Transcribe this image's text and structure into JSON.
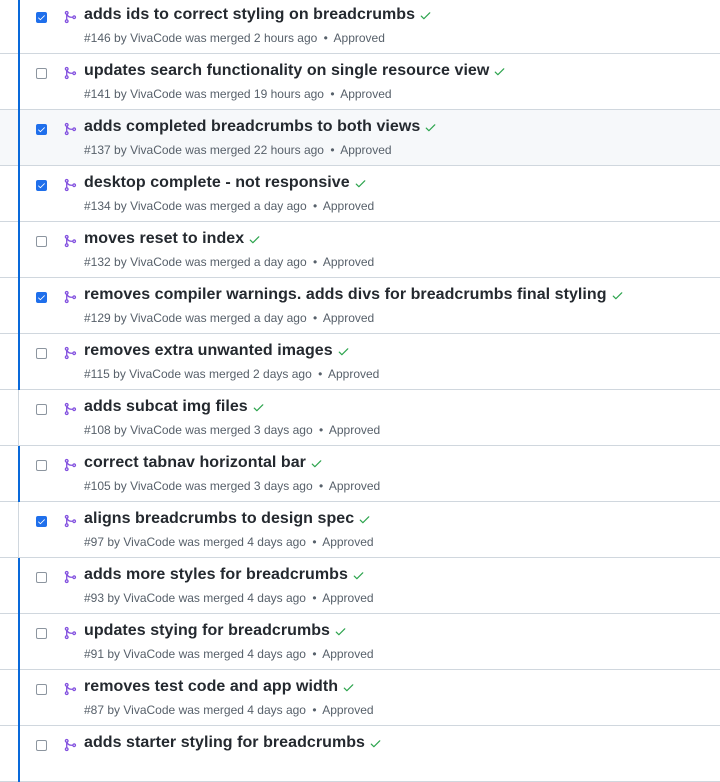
{
  "colors": {
    "accent_bar": "#0969da",
    "checkbox_checked": "#1f6feb",
    "merged_icon": "#8250df",
    "success_check": "#2da44e",
    "title_text": "#24292f",
    "meta_text": "#57606a"
  },
  "icons": {
    "merged": "git-merge-icon",
    "status": "check-icon",
    "checkbox": "checkbox"
  },
  "pull_requests": [
    {
      "title": "adds ids to correct styling on breadcrumbs",
      "number": "#146",
      "author": "VivaCode",
      "merged_text": "was merged 2 hours ago",
      "review": "Approved",
      "checked": true,
      "bar": true,
      "highlighted": false
    },
    {
      "title": "updates search functionality on single resource view",
      "number": "#141",
      "author": "VivaCode",
      "merged_text": "was merged 19 hours ago",
      "review": "Approved",
      "checked": false,
      "bar": true,
      "highlighted": false
    },
    {
      "title": "adds completed breadcrumbs to both views",
      "number": "#137",
      "author": "VivaCode",
      "merged_text": "was merged 22 hours ago",
      "review": "Approved",
      "checked": true,
      "bar": true,
      "highlighted": true
    },
    {
      "title": "desktop complete - not responsive",
      "number": "#134",
      "author": "VivaCode",
      "merged_text": "was merged a day ago",
      "review": "Approved",
      "checked": true,
      "bar": true,
      "highlighted": false
    },
    {
      "title": "moves reset to index",
      "number": "#132",
      "author": "VivaCode",
      "merged_text": "was merged a day ago",
      "review": "Approved",
      "checked": false,
      "bar": true,
      "highlighted": false
    },
    {
      "title": "removes compiler warnings. adds divs for breadcrumbs final styling",
      "number": "#129",
      "author": "VivaCode",
      "merged_text": "was merged a day ago",
      "review": "Approved",
      "checked": true,
      "bar": true,
      "highlighted": false
    },
    {
      "title": "removes extra unwanted images",
      "number": "#115",
      "author": "VivaCode",
      "merged_text": "was merged 2 days ago",
      "review": "Approved",
      "checked": false,
      "bar": true,
      "highlighted": false
    },
    {
      "title": "adds subcat img files",
      "number": "#108",
      "author": "VivaCode",
      "merged_text": "was merged 3 days ago",
      "review": "Approved",
      "checked": false,
      "bar": false,
      "highlighted": false
    },
    {
      "title": "correct tabnav horizontal bar",
      "number": "#105",
      "author": "VivaCode",
      "merged_text": "was merged 3 days ago",
      "review": "Approved",
      "checked": false,
      "bar": true,
      "highlighted": false
    },
    {
      "title": "aligns breadcrumbs to design spec",
      "number": "#97",
      "author": "VivaCode",
      "merged_text": "was merged 4 days ago",
      "review": "Approved",
      "checked": true,
      "bar": false,
      "highlighted": false
    },
    {
      "title": "adds more styles for breadcrumbs",
      "number": "#93",
      "author": "VivaCode",
      "merged_text": "was merged 4 days ago",
      "review": "Approved",
      "checked": false,
      "bar": true,
      "highlighted": false
    },
    {
      "title": "updates stying for breadcrumbs",
      "number": "#91",
      "author": "VivaCode",
      "merged_text": "was merged 4 days ago",
      "review": "Approved",
      "checked": false,
      "bar": true,
      "highlighted": false
    },
    {
      "title": "removes test code and app width",
      "number": "#87",
      "author": "VivaCode",
      "merged_text": "was merged 4 days ago",
      "review": "Approved",
      "checked": false,
      "bar": true,
      "highlighted": false
    },
    {
      "title": "adds starter styling for breadcrumbs",
      "number": "",
      "author": "",
      "merged_text": "",
      "review": "",
      "checked": false,
      "bar": true,
      "highlighted": false
    }
  ]
}
